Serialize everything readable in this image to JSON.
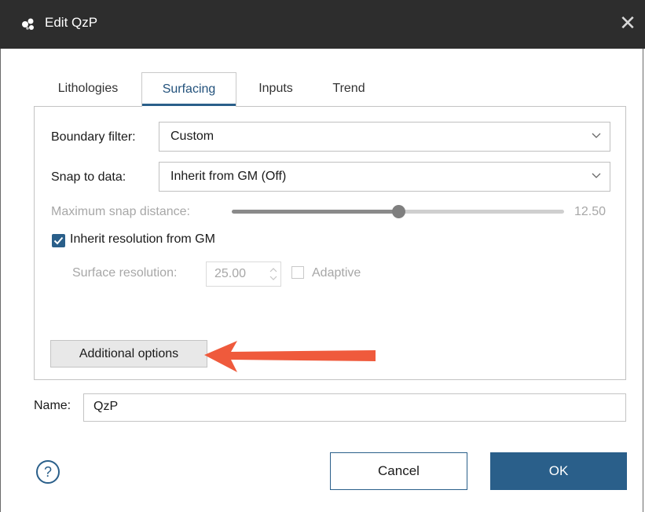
{
  "window": {
    "title": "Edit QzP",
    "close_glyph": "✕",
    "app_icon": "leapfrog-app-icon"
  },
  "tabs": [
    {
      "label": "Lithologies",
      "active": false
    },
    {
      "label": "Surfacing",
      "active": true
    },
    {
      "label": "Inputs",
      "active": false
    },
    {
      "label": "Trend",
      "active": false
    }
  ],
  "surfacing": {
    "boundary_filter": {
      "label": "Boundary filter:",
      "value": "Custom"
    },
    "snap_to_data": {
      "label": "Snap to data:",
      "value": "Inherit from GM (Off)"
    },
    "max_snap_distance": {
      "label": "Maximum snap distance:",
      "value": "12.50",
      "fraction": 0.5,
      "enabled": false
    },
    "inherit_resolution": {
      "label": "Inherit resolution from GM",
      "checked": true
    },
    "surface_resolution": {
      "label": "Surface resolution:",
      "value": "25.00",
      "enabled": false
    },
    "adaptive": {
      "label": "Adaptive",
      "checked": false,
      "enabled": false
    },
    "additional_options_label": "Additional options"
  },
  "name": {
    "label": "Name:",
    "value": "QzP"
  },
  "buttons": {
    "help": "?",
    "cancel": "Cancel",
    "ok": "OK"
  },
  "colors": {
    "accent": "#2a5f8a",
    "titlebar": "#2d2d2d",
    "annotation_arrow": "#ef5a3c",
    "disabled_text": "#a7a7a7"
  }
}
